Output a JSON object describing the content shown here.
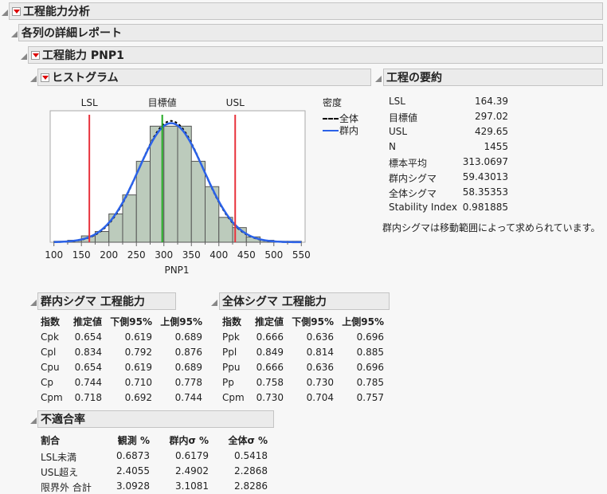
{
  "outline": {
    "main_title": "工程能力分析",
    "detail_title": "各列の詳細レポート",
    "capability_title": "工程能力 PNP1",
    "histogram_title": "ヒストグラム",
    "summary_title": "工程の要約",
    "within_title": "群内シグマ 工程能力",
    "overall_title": "全体シグマ 工程能力",
    "nonconf_title": "不適合率"
  },
  "chart_data": {
    "type": "bar",
    "xlabel": "PNP1",
    "xlim": [
      100,
      550
    ],
    "xticks": [
      "100",
      "150",
      "200",
      "250",
      "300",
      "350",
      "400",
      "450",
      "500",
      "550"
    ],
    "bin_width": 25,
    "bin_starts": [
      100,
      125,
      150,
      175,
      200,
      225,
      250,
      275,
      300,
      325,
      350,
      375,
      400,
      425,
      450,
      475,
      500,
      525
    ],
    "counts": [
      2,
      4,
      13,
      22,
      58,
      97,
      166,
      238,
      238,
      238,
      166,
      114,
      51,
      30,
      11,
      4,
      2,
      2
    ],
    "spec_labels": {
      "lsl": "LSL",
      "target": "目標値",
      "usl": "USL"
    },
    "legend": {
      "title": "密度",
      "overall": "全体",
      "within": "群内"
    },
    "colors": {
      "bar": "#bccbbc",
      "spec": "#e8323c",
      "target": "#22aa22",
      "within": "#2b62e8",
      "overall": "#000000"
    }
  },
  "summary": {
    "rows": [
      {
        "label": "LSL",
        "value": "164.39"
      },
      {
        "label": "目標値",
        "value": "297.02"
      },
      {
        "label": "USL",
        "value": "429.65"
      },
      {
        "label": "N",
        "value": "1455"
      },
      {
        "label": "標本平均",
        "value": "313.0697"
      },
      {
        "label": "群内シグマ",
        "value": "59.43013"
      },
      {
        "label": "全体シグマ",
        "value": "58.35353"
      },
      {
        "label": "Stability Index",
        "value": "0.981885"
      }
    ],
    "note": "群内シグマは移動範囲によって求められています。"
  },
  "within": {
    "headers": [
      "指数",
      "推定値",
      "下側95%",
      "上側95%"
    ],
    "rows": [
      [
        "Cpk",
        "0.654",
        "0.619",
        "0.689"
      ],
      [
        "Cpl",
        "0.834",
        "0.792",
        "0.876"
      ],
      [
        "Cpu",
        "0.654",
        "0.619",
        "0.689"
      ],
      [
        "Cp",
        "0.744",
        "0.710",
        "0.778"
      ],
      [
        "Cpm",
        "0.718",
        "0.692",
        "0.744"
      ]
    ]
  },
  "overall": {
    "headers": [
      "指数",
      "推定値",
      "下側95%",
      "上側95%"
    ],
    "rows": [
      [
        "Ppk",
        "0.666",
        "0.636",
        "0.696"
      ],
      [
        "Ppl",
        "0.849",
        "0.814",
        "0.885"
      ],
      [
        "Ppu",
        "0.666",
        "0.636",
        "0.696"
      ],
      [
        "Pp",
        "0.758",
        "0.730",
        "0.785"
      ],
      [
        "Cpm",
        "0.730",
        "0.704",
        "0.757"
      ]
    ]
  },
  "nonconf": {
    "headers": [
      "割合",
      "観測 %",
      "群内σ %",
      "全体σ %"
    ],
    "rows": [
      [
        "LSL未満",
        "0.6873",
        "0.6179",
        "0.5418"
      ],
      [
        "USL超え",
        "2.4055",
        "2.4902",
        "2.2868"
      ],
      [
        "限界外 合計",
        "3.0928",
        "3.1081",
        "2.8286"
      ]
    ]
  }
}
